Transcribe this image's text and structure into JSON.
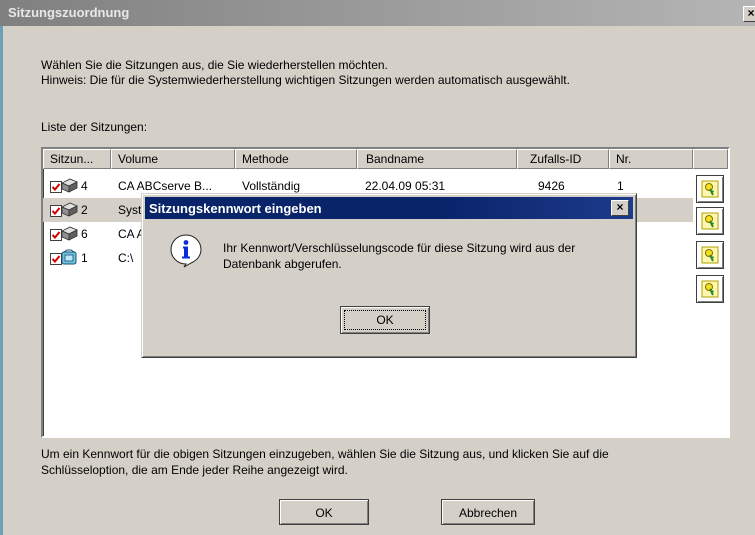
{
  "window": {
    "title": "Sitzungszuordnung",
    "close_glyph": "×",
    "instructions_line1": "Wählen Sie die Sitzungen aus, die Sie wiederherstellen möchten.",
    "instructions_line2": "Hinweis: Die für die Systemwiederherstellung wichtigen Sitzungen werden automatisch ausgewählt.",
    "list_label": "Liste der Sitzungen:",
    "footer_line1": "Um ein Kennwort für die obigen Sitzungen einzugeben, wählen Sie die Sitzung aus, und klicken Sie auf die",
    "footer_line2": "Schlüsseloption, die am Ende jeder Reihe angezeigt wird.",
    "ok_label": "OK",
    "cancel_label": "Abbrechen"
  },
  "table": {
    "columns": [
      "Sitzun...",
      "Volume",
      "Methode",
      "Bandname",
      "Zufalls-ID",
      "Nr."
    ],
    "rows": [
      {
        "session": "4",
        "volume": "CA ABCserve B...",
        "method": "Vollständig",
        "tape": "22.04.09 05:31",
        "random_id": "9426",
        "nr": "1",
        "icon": "tape-icon"
      },
      {
        "session": "2",
        "volume": "Syst",
        "method": "",
        "tape": "",
        "random_id": "",
        "nr": "",
        "icon": "tape-icon"
      },
      {
        "session": "6",
        "volume": "CA A",
        "method": "",
        "tape": "",
        "random_id": "",
        "nr": "",
        "icon": "tape-icon"
      },
      {
        "session": "1",
        "volume": "C:\\",
        "method": "",
        "tape": "",
        "random_id": "",
        "nr": "",
        "icon": "drive-icon"
      }
    ]
  },
  "dialog": {
    "title": "Sitzungskennwort eingeben",
    "close_glyph": "×",
    "message_line1": "Ihr Kennwort/Verschlüsselungscode für diese Sitzung wird aus der",
    "message_line2": "Datenbank abgerufen.",
    "ok_label": "OK",
    "icon": "info-icon"
  }
}
